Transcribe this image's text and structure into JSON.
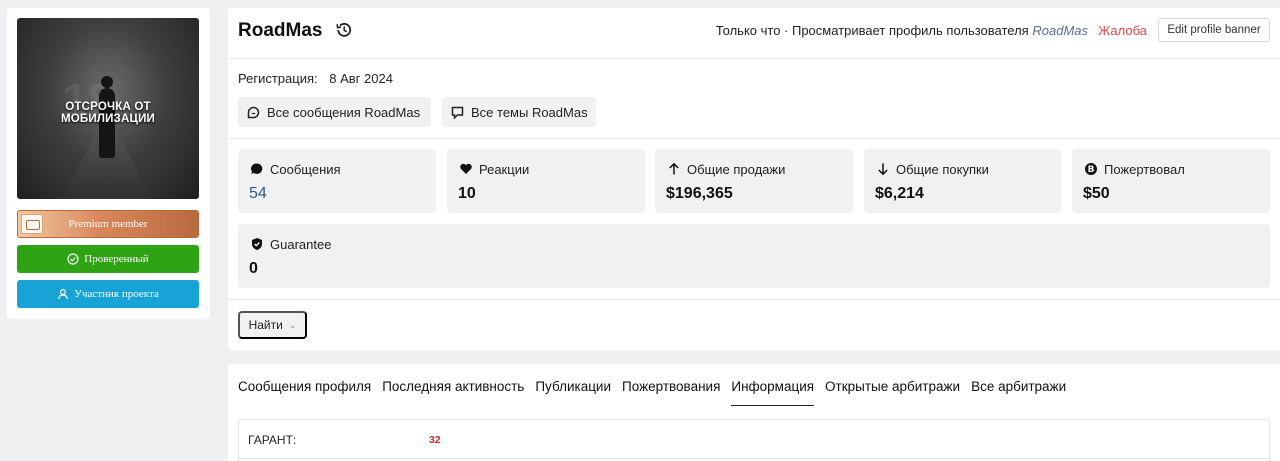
{
  "sidebar": {
    "avatar_text": "ОТСРОЧКА ОТ МОБИЛИЗАЦИИ",
    "badges": {
      "premium": "Premium member",
      "verified": "Проверенный",
      "member": "Участник проекта"
    }
  },
  "header": {
    "username": "RoadMas",
    "status_prefix": "Только что · Просматривает профиль пользователя",
    "status_user": "RoadMas",
    "report_label": "Жалоба",
    "edit_banner_label": "Edit profile banner"
  },
  "info": {
    "registration_label": "Регистрация:",
    "registration_date": "8 Авг 2024",
    "all_messages_label": "Все сообщения RoadMas",
    "all_threads_label": "Все темы RoadMas"
  },
  "stats": {
    "messages": {
      "label": "Сообщения",
      "value": "54"
    },
    "reactions": {
      "label": "Реакции",
      "value": "10"
    },
    "total_sales": {
      "label": "Общие продажи",
      "value": "$196,365"
    },
    "total_purchases": {
      "label": "Общие покупки",
      "value": "$6,214"
    },
    "donated": {
      "label": "Пожертвовал",
      "value": "$50"
    },
    "guarantee": {
      "label": "Guarantee",
      "value": "0"
    }
  },
  "find": {
    "label": "Найти"
  },
  "tabs": [
    {
      "label": "Сообщения профиля"
    },
    {
      "label": "Последняя активность"
    },
    {
      "label": "Публикации"
    },
    {
      "label": "Пожертвования"
    },
    {
      "label": "Информация"
    },
    {
      "label": "Открытые арбитражи"
    },
    {
      "label": "Все арбитражи"
    }
  ],
  "info_panel": {
    "guarantor_label": "ГАРАНТ:",
    "guarantor_value": "32"
  },
  "colors": {
    "verified": "#2ea314",
    "member": "#18a3d6",
    "report": "#e04848",
    "messages_value": "#2d5a86"
  }
}
